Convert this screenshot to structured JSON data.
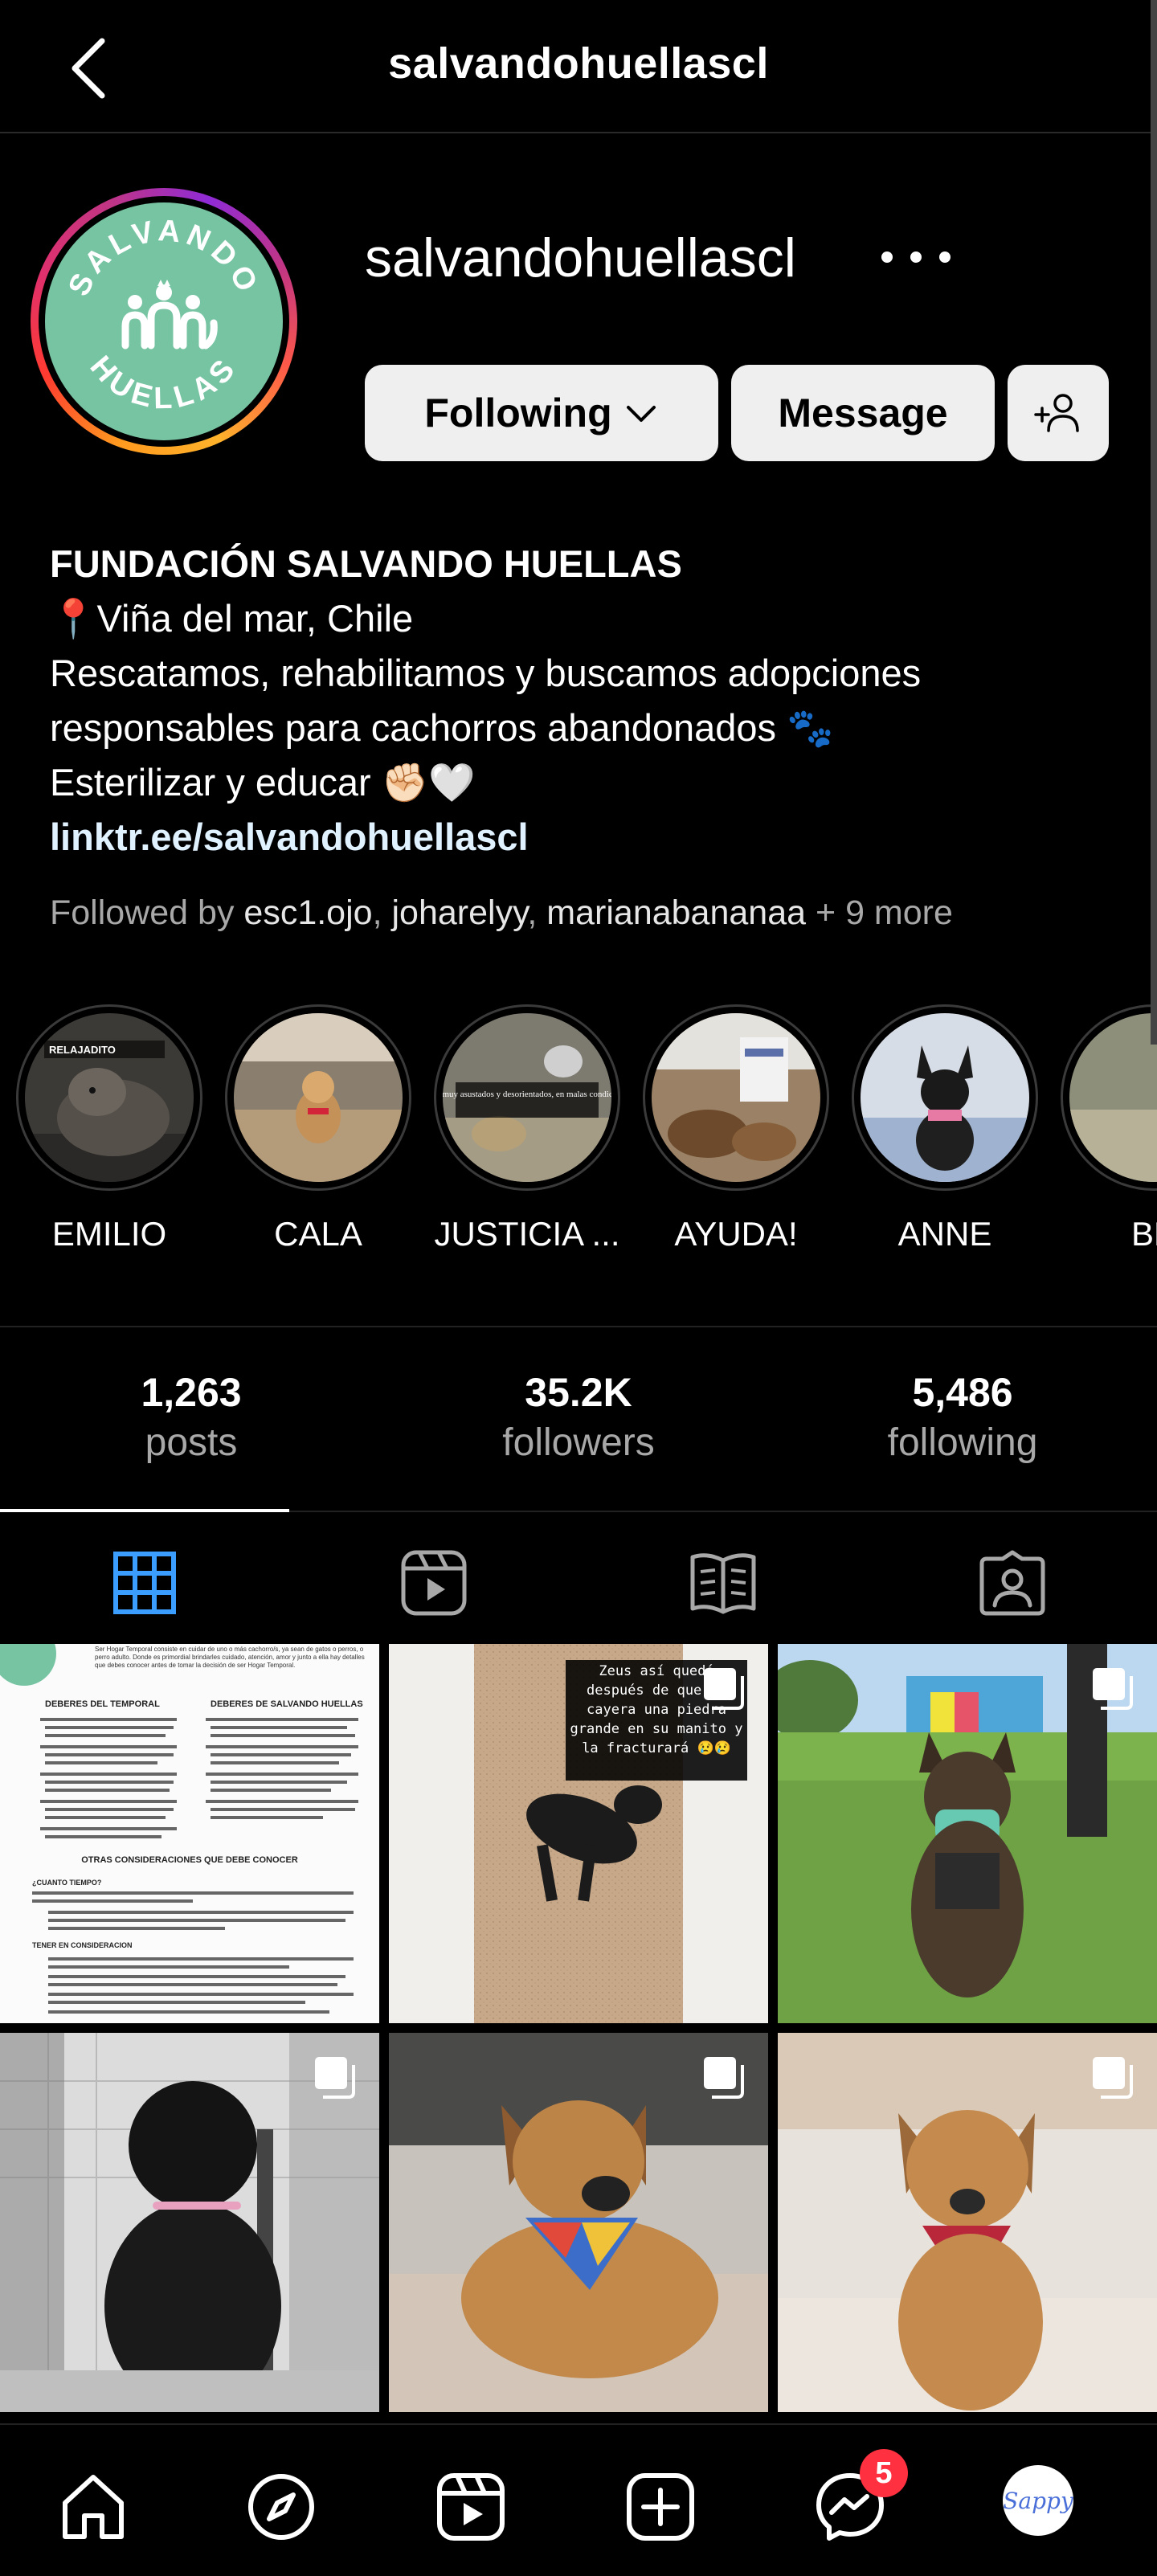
{
  "topbar": {
    "title": "salvandohuellascl"
  },
  "profile": {
    "username": "salvandohuellascl",
    "avatar_text": [
      "SALVANDO",
      "HUELLAS"
    ],
    "buttons": {
      "following": "Following",
      "message": "Message"
    }
  },
  "bio": {
    "name": "FUNDACIÓN SALVANDO HUELLAS",
    "location": "📍Viña del mar, Chile",
    "line1": "Rescatamos, rehabilitamos y buscamos adopciones",
    "line2": "responsables para cachorros abandonados 🐾",
    "line3": "Esterilizar y educar ✊🏻🤍",
    "link": "linktr.ee/salvandohuellascl"
  },
  "followed_by": {
    "prefix": "Followed by ",
    "names": [
      "esc1.ojo",
      "joharelyy",
      "marianabananaa"
    ],
    "suffix": " + 9 more"
  },
  "highlights": [
    {
      "label": "EMILIO",
      "caption": "RELAJADITO"
    },
    {
      "label": "CALA"
    },
    {
      "label": "JUSTICIA ...",
      "caption": "Estan muy asustados y desorientados, en malas condiciones."
    },
    {
      "label": "AYUDA!"
    },
    {
      "label": "ANNE"
    },
    {
      "label": "BE"
    }
  ],
  "stats": {
    "posts": {
      "value": "1,263",
      "label": "posts"
    },
    "followers": {
      "value": "35.2K",
      "label": "followers"
    },
    "following": {
      "value": "5,486",
      "label": "following"
    }
  },
  "tabs": [
    "grid-icon",
    "reels-icon",
    "guides-icon",
    "tagged-icon"
  ],
  "posts": {
    "p1": {
      "intro": "Ser Hogar Temporal consiste en cuidar de uno o más cachorro/s, ya sean de gatos o perros, o perro adulto. Donde es primordial brindarles cuidado, atención, amor y junto a ella hay detalles que debes conocer antes de tomar la decisión de ser Hogar Temporal.",
      "col1_title": "DEBERES DEL TEMPORAL",
      "col2_title": "DEBERES DE SALVANDO HUELLAS",
      "bottom_title": "OTRAS CONSIDERACIONES QUE DEBE CONOCER",
      "q1": "¿CUANTO TIEMPO?",
      "q2": "TENER EN CONSIDERACION"
    },
    "p2": {
      "caption": "Zeus así quedó después de que le cayera una piedra grande en su manito y la fracturará 😢😢"
    }
  },
  "nav": {
    "items": [
      "home-icon",
      "explore-icon",
      "reels-icon",
      "create-icon",
      "messenger-icon",
      "profile-avatar"
    ],
    "messenger_badge": "5",
    "profile_text": "Sappy"
  },
  "colors": {
    "background": "#000000",
    "button_bg": "#efefef",
    "grid_tab_active": "#3b9dff",
    "badge": "#ff3040",
    "avatar_green": "#77c4a3"
  }
}
